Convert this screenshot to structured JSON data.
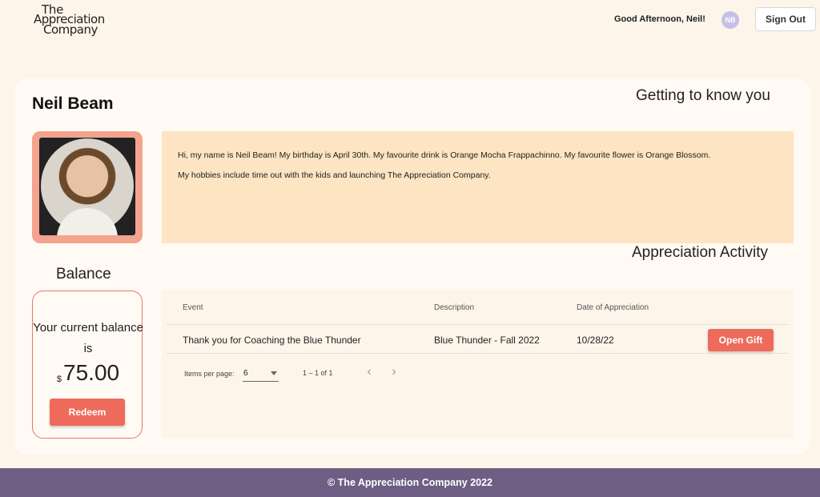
{
  "header": {
    "logo_line1": "The",
    "logo_line2": "Appreciation",
    "logo_line3": "Company",
    "greeting": "Good Afternoon, Neil!",
    "user_initials": "NB",
    "signout_label": "Sign Out"
  },
  "profile": {
    "name": "Neil Beam",
    "about_title": "Getting to know you",
    "about_line1": "Hi, my name is Neil Beam! My birthday is April 30th. My favourite drink is Orange Mocha Frappachinno. My favourite flower is Orange Blossom.",
    "about_line2": "My hobbies include time out with the kids and launching The Appreciation Company."
  },
  "balance": {
    "title": "Balance",
    "text": "Your current balance is",
    "currency": "$",
    "amount": "75.00",
    "redeem_label": "Redeem"
  },
  "activity": {
    "title": "Appreciation Activity",
    "columns": [
      "Event",
      "Description",
      "Date of Appreciation"
    ],
    "rows": [
      {
        "event": "Thank you for Coaching the Blue Thunder",
        "description": "Blue Thunder - Fall 2022",
        "date": "10/28/22",
        "action": "Open Gift"
      }
    ],
    "pager": {
      "items_per_page_label": "Items per page:",
      "items_per_page": "6",
      "range": "1 – 1 of 1",
      "prev_icon": "‹",
      "next_icon": "›"
    }
  },
  "footer": {
    "text": "© The Appreciation Company 2022"
  },
  "colors": {
    "background": "#fdf5ea",
    "accent": "#ee6b5b",
    "photo_frame": "#f3a38e",
    "about_box": "#fde4c2",
    "footer": "#6e5e84"
  }
}
